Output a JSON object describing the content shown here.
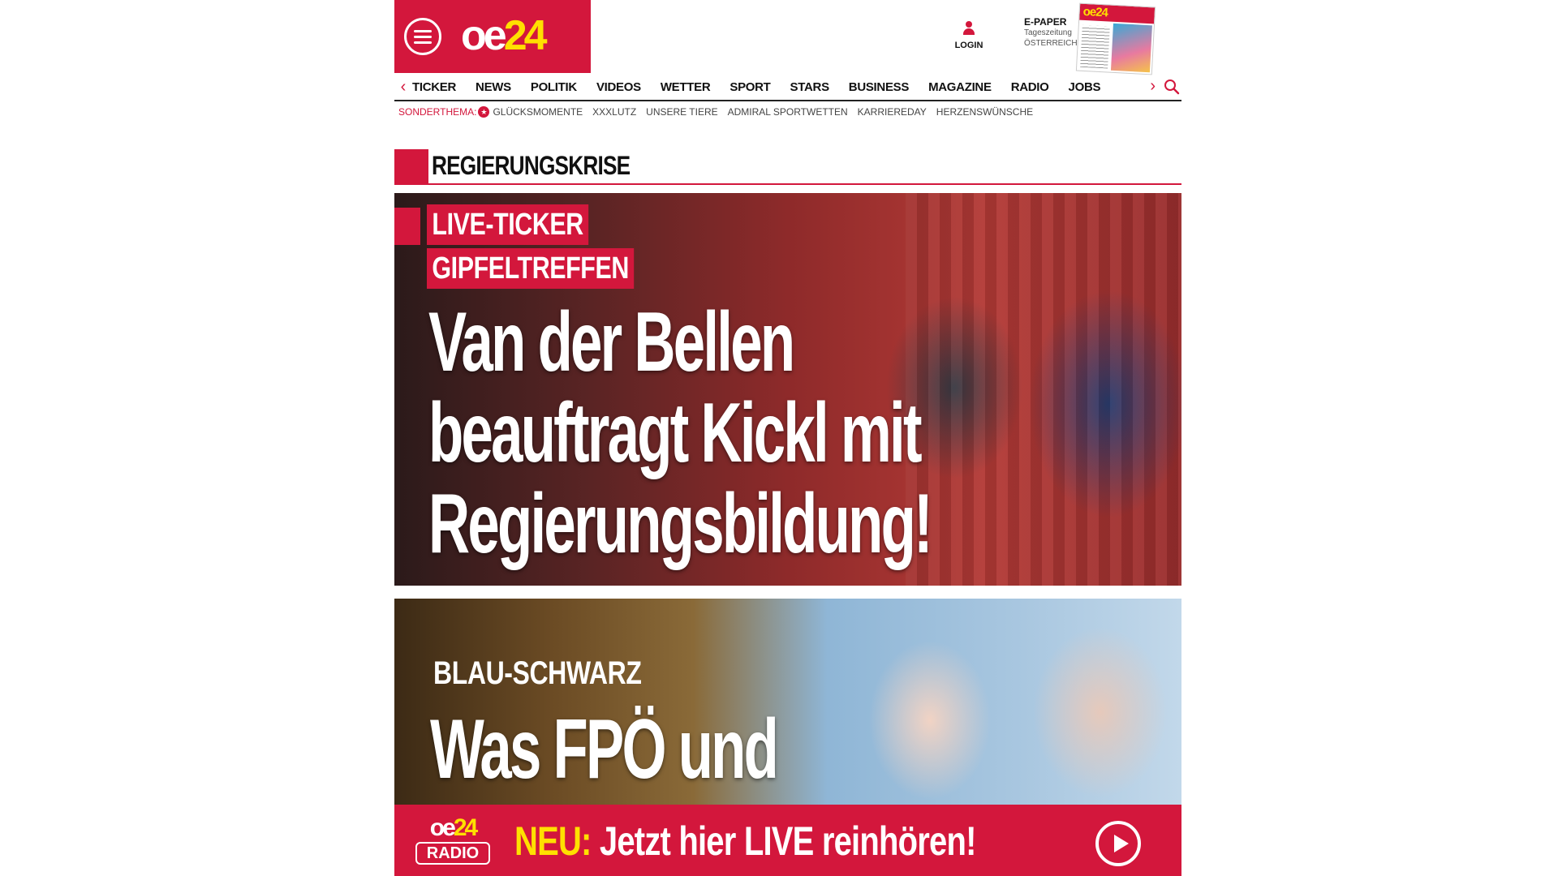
{
  "header": {
    "logo": {
      "oe": "oe",
      "num": "24"
    },
    "login_label": "LOGIN",
    "epaper": {
      "title": "E-PAPER",
      "line1": "Tageszeitung",
      "line2": "ÖSTERREICH",
      "cover_logo": "oe24"
    }
  },
  "nav": {
    "items": [
      "TICKER",
      "NEWS",
      "POLITIK",
      "VIDEOS",
      "WETTER",
      "SPORT",
      "STARS",
      "BUSINESS",
      "MAGAZINE",
      "RADIO",
      "JOBS"
    ],
    "prev_icon": "chevron-left-icon",
    "next_icon": "chevron-right-icon",
    "search_icon": "search-icon"
  },
  "subnav": {
    "label": "SONDERTHEMA:",
    "items": [
      "GLÜCKSMOMENTE",
      "XXXLUTZ",
      "UNSERE TIERE",
      "ADMIRAL SPORTWETTEN",
      "KARRIEREDAY",
      "HERZENSWÜNSCHE"
    ]
  },
  "section": {
    "title": "REGIERUNGSKRISE"
  },
  "hero": {
    "kicker1": "LIVE-TICKER",
    "kicker2": "GIPFELTREFFEN",
    "headline": "Van der Bellen beauftragt Kickl mit Regierungsbildung!"
  },
  "second": {
    "kicker": "BLAU-SCHWARZ",
    "headline": "Was FPÖ und"
  },
  "radio": {
    "logo_top_oe": "oe",
    "logo_top_num": "24",
    "logo_box": "RADIO",
    "new_label": "NEU:",
    "message": "Jetzt hier LIVE reinhören!",
    "play_icon": "play-icon"
  },
  "colors": {
    "brand_red": "#d3173c",
    "brand_yellow": "#ffe000"
  }
}
